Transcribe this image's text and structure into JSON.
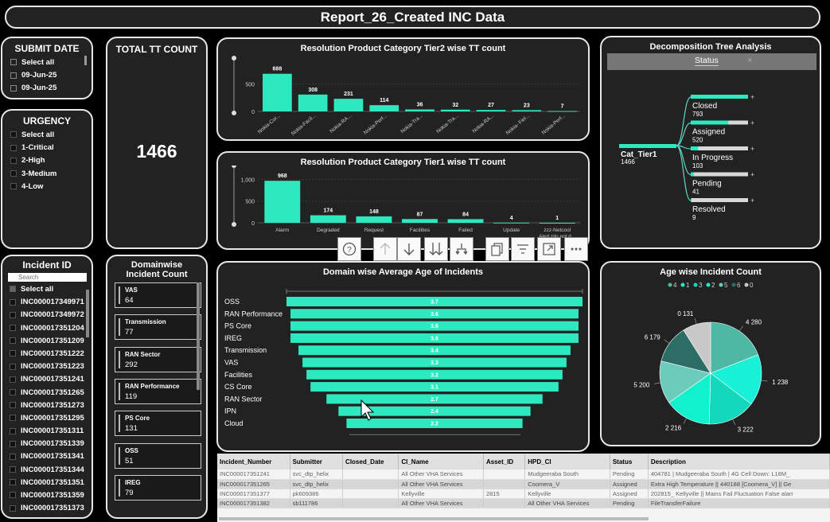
{
  "header": {
    "title": "Report_26_Created INC Data"
  },
  "submit_date": {
    "title": "SUBMIT DATE",
    "items": [
      "Select all",
      "09-Jun-25",
      "09-Jun-25"
    ]
  },
  "urgency": {
    "title": "URGENCY",
    "items": [
      "Select all",
      "1-Critical",
      "2-High",
      "3-Medium",
      "4-Low"
    ]
  },
  "total": {
    "title": "TOTAL TT COUNT",
    "value": "1466"
  },
  "incident_id": {
    "title": "Incident ID",
    "search_placeholder": "Search",
    "items": [
      "Select all",
      "INC000017349971",
      "INC000017349972",
      "INC000017351204",
      "INC000017351209",
      "INC000017351222",
      "INC000017351223",
      "INC000017351241",
      "INC000017351265",
      "INC000017351273",
      "INC000017351295",
      "INC000017351311",
      "INC000017351339",
      "INC000017351341",
      "INC000017351344",
      "INC000017351351",
      "INC000017351359",
      "INC000017351373"
    ]
  },
  "domainwise": {
    "title": "Domainwise Incident Count",
    "items": [
      {
        "name": "VAS",
        "value": "64"
      },
      {
        "name": "Transmission",
        "value": "77"
      },
      {
        "name": "RAN Sector",
        "value": "292"
      },
      {
        "name": "RAN Performance",
        "value": "119"
      },
      {
        "name": "PS Core",
        "value": "131"
      },
      {
        "name": "OSS",
        "value": "51"
      },
      {
        "name": "IREG",
        "value": "79"
      }
    ]
  },
  "tier2": {
    "title": "Resolution Product Category Tier2 wise TT count"
  },
  "tier1": {
    "title": "Resolution Product Category Tier1 wise TT count"
  },
  "age": {
    "title": "Domain wise Average Age of Incidents"
  },
  "decomp": {
    "title": "Decomposition Tree Analysis",
    "header": "Status",
    "root_label": "Cat_Tier1",
    "root_value": "1466",
    "nodes": [
      {
        "label": "Closed",
        "value": "793",
        "frac": 0.54
      },
      {
        "label": "Assigned",
        "value": "520",
        "frac": 0.355
      },
      {
        "label": "In Progress",
        "value": "103",
        "frac": 0.07
      },
      {
        "label": "Pending",
        "value": "41",
        "frac": 0.028
      },
      {
        "label": "Resolved",
        "value": "9",
        "frac": 0.006
      }
    ]
  },
  "agepie": {
    "title": "Age wise Incident Count"
  },
  "toolbar": {
    "icons": [
      "help-icon",
      "arrow-up-icon",
      "arrow-down-icon",
      "double-arrow-down-icon",
      "expand-hierarchy-icon",
      "copy-icon",
      "filter-icon",
      "focus-mode-icon",
      "more-options-icon"
    ]
  },
  "table": {
    "columns": [
      "Incident_Number",
      "Submitter",
      "Closed_Date",
      "CI_Name",
      "Asset_ID",
      "HPD_CI",
      "Status",
      "Description"
    ],
    "rows": [
      [
        "INC000017351241",
        "svc_dtp_helix",
        "",
        "All Other VHA Services",
        "",
        "Mudgeeraba South",
        "Pending",
        "404781 | Mudgeeraba South | 4G Cell Down: L18M_"
      ],
      [
        "INC000017351265",
        "svc_dtp_helix",
        "",
        "All Other VHA Services",
        "",
        "Coomera_V",
        "Assigned",
        "Extra High Temperature || 440188 [Coomera_V] || Ge"
      ],
      [
        "INC000017351377",
        "pk609386",
        "",
        "Kellyville",
        "2815",
        "Kellyville",
        "Assigned",
        "202815_ Kellyville || Mains Fail Fluctuation False alarr"
      ],
      [
        "INC000017351382",
        "sb111786",
        "",
        "All Other VHA Services",
        "",
        "All Other VHA Services",
        "Pending",
        "FileTransferFailure"
      ]
    ]
  },
  "chart_data": [
    {
      "type": "bar",
      "title": "Resolution Product Category Tier2 wise TT count",
      "categories": [
        "Nokia-Cor...",
        "Nokia-Facil...",
        "Nokia-RA...",
        "Nokia-Perf...",
        "Nokia-Tra...",
        "Nokia-Tra...",
        "Nokia-RA...",
        "Nokia- Fiel...",
        "Nokia-Perf..."
      ],
      "values": [
        688,
        308,
        231,
        114,
        36,
        32,
        27,
        23,
        7
      ],
      "yticks": [
        "0",
        "500"
      ],
      "ylim": [
        0,
        800
      ],
      "color": "#2ee8c0"
    },
    {
      "type": "bar",
      "title": "Resolution Product Category Tier1 wise TT count",
      "categories": [
        "Alarm",
        "Degraded",
        "Request",
        "Facilities",
        "Failed",
        "Update",
        "zzz-Netcool Alert (do not d..."
      ],
      "values": [
        968,
        174,
        148,
        87,
        84,
        4,
        1
      ],
      "yticks": [
        "0",
        "500",
        "1,000"
      ],
      "ylim": [
        0,
        1100
      ],
      "color": "#2ee8c0"
    },
    {
      "type": "bar",
      "orientation": "funnel",
      "title": "Domain wise Average Age of Incidents",
      "categories": [
        "OSS",
        "RAN Performance",
        "PS Core",
        "IREG",
        "Transmission",
        "VAS",
        "Facilities",
        "CS Core",
        "RAN Sector",
        "IPN",
        "Cloud"
      ],
      "values": [
        3.7,
        3.6,
        3.6,
        3.6,
        3.4,
        3.3,
        3.2,
        3.1,
        2.7,
        2.4,
        2.2
      ],
      "color": "#2ee8c0"
    },
    {
      "type": "pie",
      "title": "Age wise Incident Count",
      "legend": [
        "4",
        "1",
        "3",
        "2",
        "5",
        "6",
        "0"
      ],
      "slices": [
        {
          "name": "4",
          "value": 280,
          "label": "4 280",
          "color": "#4fb8a4"
        },
        {
          "name": "1",
          "value": 238,
          "label": "1 238",
          "color": "#19f0d8"
        },
        {
          "name": "3",
          "value": 222,
          "label": "3 222",
          "color": "#14d8bc"
        },
        {
          "name": "2",
          "value": 216,
          "label": "2 216",
          "color": "#10f2cc"
        },
        {
          "name": "5",
          "value": 200,
          "label": "5 200",
          "color": "#6cccbc"
        },
        {
          "name": "6",
          "value": 179,
          "label": "6 179",
          "color": "#2c6e66"
        },
        {
          "name": "0",
          "value": 131,
          "label": "0 131",
          "color": "#c8c8c8"
        }
      ]
    }
  ]
}
